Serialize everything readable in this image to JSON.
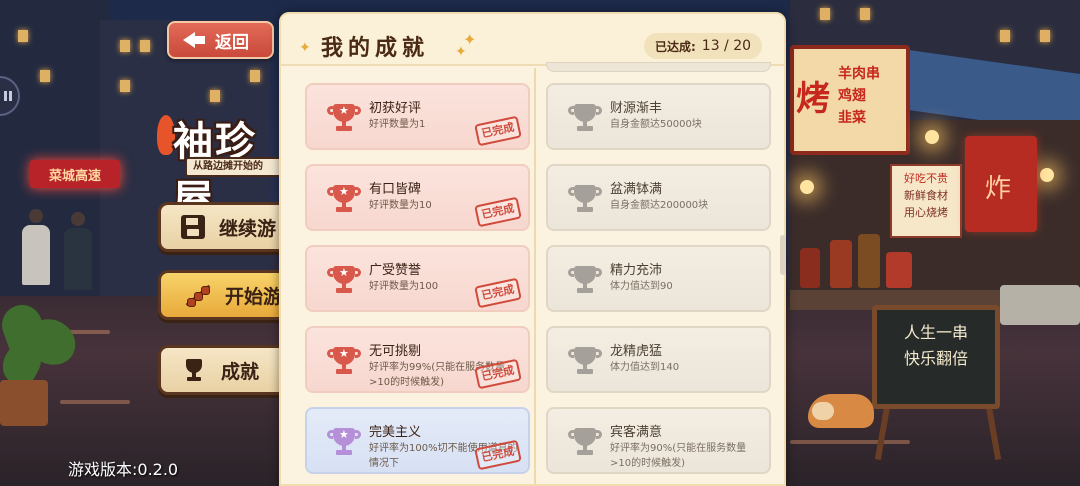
{
  "menu": {
    "back_label": "返回",
    "logo_title": "袖珍屋",
    "logo_subtitle": "从路边摊开始的",
    "continue_label": "继续游",
    "start_label": "开始游",
    "achievements_label": "成就",
    "version_text": "游戏版本:0.2.0"
  },
  "scene": {
    "shop_sign": "菜城高速",
    "bbq_big": "烤",
    "bbq_items": [
      "羊肉串",
      "鸡翅",
      "韭菜"
    ],
    "notice_lines": [
      "好吃不贵",
      "新鲜食材",
      "用心烧烤"
    ],
    "red_banner": "炸",
    "chalkboard_lines": [
      "人生一串",
      "快乐翻倍"
    ]
  },
  "panel": {
    "title": "我的成就",
    "progress_label": "已达成:",
    "progress_value": "13 / 20",
    "stamp_text": "已完成"
  },
  "achievements_left": [
    {
      "title": "初获好评",
      "desc": "好评数量为1",
      "state": "completed"
    },
    {
      "title": "有口皆碑",
      "desc": "好评数量为10",
      "state": "completed"
    },
    {
      "title": "广受赞誉",
      "desc": "好评数量为100",
      "state": "completed"
    },
    {
      "title": "无可挑剔",
      "desc": "好评率为99%(只能在服务数量>10的时候触发)",
      "state": "completed"
    },
    {
      "title": "完美主义",
      "desc": "好评率为100%切不能使用道具的情况下",
      "state": "completed-gold"
    }
  ],
  "achievements_right": [
    {
      "title": "财源渐丰",
      "desc": "自身金额达50000块",
      "state": "locked"
    },
    {
      "title": "盆满钵满",
      "desc": "自身金额达200000块",
      "state": "locked"
    },
    {
      "title": "精力充沛",
      "desc": "体力值达到90",
      "state": "locked"
    },
    {
      "title": "龙精虎猛",
      "desc": "体力值达到140",
      "state": "locked"
    },
    {
      "title": "宾客满意",
      "desc": "好评率为90%(只能在服务数量>10的时候触发)",
      "state": "locked"
    }
  ],
  "icons": {
    "back": "arrow-left-icon",
    "save": "save-icon",
    "start": "skewer-icon",
    "achievement": "trophy-icon"
  },
  "colors": {
    "completed_trophy": "#d8594b",
    "locked_trophy": "#a5a19a",
    "gold_trophy": "#b590d8",
    "stamp": "#d04b3c"
  }
}
